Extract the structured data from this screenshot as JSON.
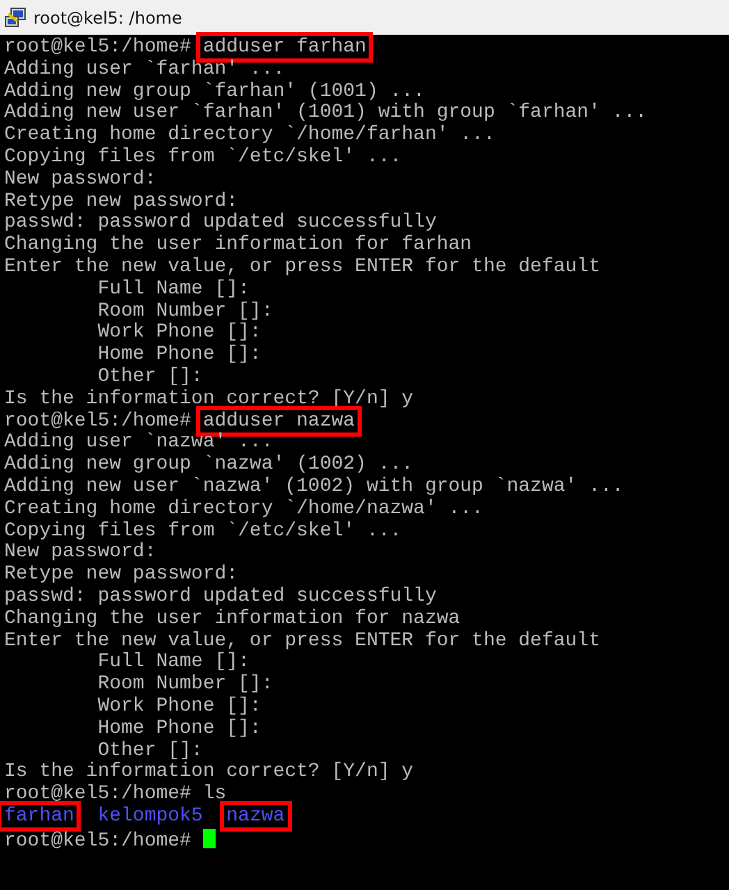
{
  "window": {
    "title": "root@kel5: /home"
  },
  "lines": [
    {
      "kind": "prompt",
      "prompt": "root@kel5:/home#",
      "command": "adduser farhan",
      "highlighted": true
    },
    {
      "kind": "output",
      "text": "Adding user `farhan' ..."
    },
    {
      "kind": "output",
      "text": "Adding new group `farhan' (1001) ..."
    },
    {
      "kind": "output",
      "text": "Adding new user `farhan' (1001) with group `farhan' ..."
    },
    {
      "kind": "output",
      "text": "Creating home directory `/home/farhan' ..."
    },
    {
      "kind": "output",
      "text": "Copying files from `/etc/skel' ..."
    },
    {
      "kind": "output",
      "text": "New password:"
    },
    {
      "kind": "output",
      "text": "Retype new password:"
    },
    {
      "kind": "output",
      "text": "passwd: password updated successfully"
    },
    {
      "kind": "output",
      "text": "Changing the user information for farhan"
    },
    {
      "kind": "output",
      "text": "Enter the new value, or press ENTER for the default"
    },
    {
      "kind": "output",
      "text": "        Full Name []:"
    },
    {
      "kind": "output",
      "text": "        Room Number []:"
    },
    {
      "kind": "output",
      "text": "        Work Phone []:"
    },
    {
      "kind": "output",
      "text": "        Home Phone []:"
    },
    {
      "kind": "output",
      "text": "        Other []:"
    },
    {
      "kind": "output",
      "text": "Is the information correct? [Y/n] y"
    },
    {
      "kind": "prompt",
      "prompt": "root@kel5:/home#",
      "command": "adduser nazwa",
      "highlighted": true
    },
    {
      "kind": "output",
      "text": "Adding user `nazwa' ..."
    },
    {
      "kind": "output",
      "text": "Adding new group `nazwa' (1002) ..."
    },
    {
      "kind": "output",
      "text": "Adding new user `nazwa' (1002) with group `nazwa' ..."
    },
    {
      "kind": "output",
      "text": "Creating home directory `/home/nazwa' ..."
    },
    {
      "kind": "output",
      "text": "Copying files from `/etc/skel' ..."
    },
    {
      "kind": "output",
      "text": "New password:"
    },
    {
      "kind": "output",
      "text": "Retype new password:"
    },
    {
      "kind": "output",
      "text": "passwd: password updated successfully"
    },
    {
      "kind": "output",
      "text": "Changing the user information for nazwa"
    },
    {
      "kind": "output",
      "text": "Enter the new value, or press ENTER for the default"
    },
    {
      "kind": "output",
      "text": "        Full Name []:"
    },
    {
      "kind": "output",
      "text": "        Room Number []:"
    },
    {
      "kind": "output",
      "text": "        Work Phone []:"
    },
    {
      "kind": "output",
      "text": "        Home Phone []:"
    },
    {
      "kind": "output",
      "text": "        Other []:"
    },
    {
      "kind": "output",
      "text": "Is the information correct? [Y/n] y"
    },
    {
      "kind": "prompt",
      "prompt": "root@kel5:/home#",
      "command": "ls",
      "highlighted": false
    },
    {
      "kind": "listing",
      "entries": [
        {
          "name": "farhan",
          "highlighted": true
        },
        {
          "name": "kelompok5",
          "highlighted": false
        },
        {
          "name": "nazwa",
          "highlighted": true
        }
      ]
    },
    {
      "kind": "prompt",
      "prompt": "root@kel5:/home#",
      "cursor": true
    }
  ]
}
